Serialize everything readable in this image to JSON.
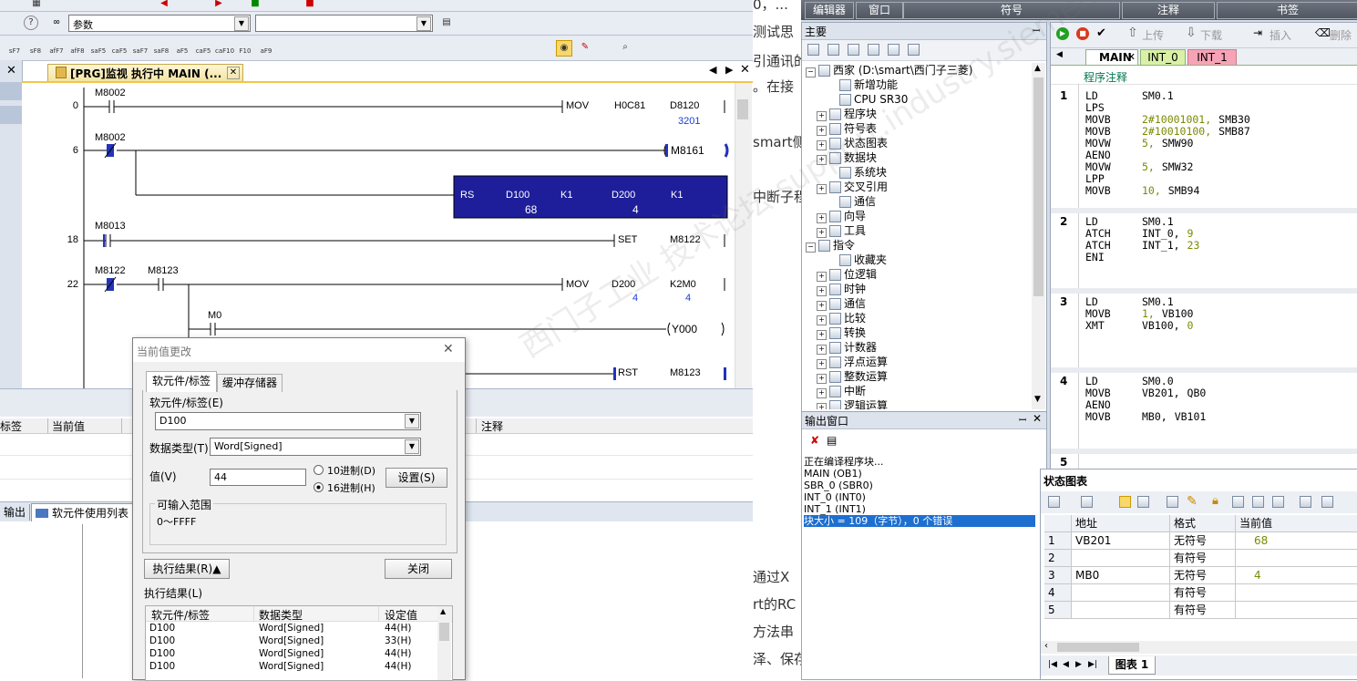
{
  "gxworks": {
    "toolbar_combo1": "参数",
    "tab_title": "[PRG]监视 执行中 MAIN (...",
    "toolbar_sf_labels": [
      "sF7",
      "sF8",
      "afF7",
      "afF8",
      "saF5",
      "caF5",
      "saF7",
      "saF8",
      "aF5",
      "caF5",
      "caF10",
      "F10",
      "aF9"
    ],
    "rungs": [
      {
        "step": "0",
        "contact": "M8002",
        "instr": "MOV",
        "op1": "H0C81",
        "op2": "D8120",
        "val2": "3201"
      },
      {
        "step": "6",
        "contact": "M8002",
        "coil": "M8161"
      },
      {
        "rs_instr": "RS",
        "rs_args": [
          "D100",
          "K1",
          "D200",
          "K1"
        ],
        "rs_vals": [
          "68",
          "4"
        ]
      },
      {
        "step": "18",
        "contact": "M8013",
        "instr": "SET",
        "op1": "M8122"
      },
      {
        "step": "22",
        "contact": "M8122",
        "contact2": "M8123",
        "instr": "MOV",
        "op1": "D200",
        "op2": "K2M0",
        "val1": "4",
        "val2": "4"
      },
      {
        "contact": "M0",
        "coil": "Y000"
      },
      {
        "instr": "RST",
        "op1": "M8123"
      }
    ],
    "bottom_headers": [
      "标签",
      "当前值",
      "",
      "注释"
    ],
    "bottom_tabs": [
      "输出",
      "软元件使用列表"
    ]
  },
  "dialog": {
    "title": "当前值更改",
    "tabs": [
      "软元件/标签",
      "缓冲存储器"
    ],
    "device_label": "软元件/标签(E)",
    "device_value": "D100",
    "datatype_label": "数据类型(T)",
    "datatype_value": "Word[Signed]",
    "value_label": "值(V)",
    "value": "44",
    "radio_dec": "10进制(D)",
    "radio_hex": "16进制(H)",
    "set_button": "设置(S)",
    "range_label": "可输入范围",
    "range_value": "0～FFFF",
    "result_button": "执行结果(R)▲",
    "close_button": "关闭",
    "result_label": "执行结果(L)",
    "result_headers": [
      "软元件/标签",
      "数据类型",
      "设定值"
    ],
    "result_rows": [
      [
        "D100",
        "Word[Signed]",
        "44(H)"
      ],
      [
        "D100",
        "Word[Signed]",
        "33(H)"
      ],
      [
        "D100",
        "Word[Signed]",
        "44(H)"
      ],
      [
        "D100",
        "Word[Signed]",
        "44(H)"
      ]
    ]
  },
  "article": {
    "fragments": [
      "0，...",
      "测试思",
      "引通讯的",
      "。在接",
      "smart侧",
      "中断子程",
      "通过X",
      "rt的RC",
      "方法串",
      "泽、保存"
    ]
  },
  "smart": {
    "menu_tabs": [
      "编辑器",
      "窗口",
      "符号",
      "注释",
      "书签"
    ],
    "tree_panel_title": "主要",
    "tree_items": [
      {
        "label": "西家 (D:\\smart\\西门子三菱)",
        "indent": 0
      },
      {
        "label": "新增功能",
        "indent": 2
      },
      {
        "label": "CPU SR30",
        "indent": 2
      },
      {
        "label": "程序块",
        "indent": 1
      },
      {
        "label": "符号表",
        "indent": 1
      },
      {
        "label": "状态图表",
        "indent": 1
      },
      {
        "label": "数据块",
        "indent": 1
      },
      {
        "label": "系统块",
        "indent": 2
      },
      {
        "label": "交叉引用",
        "indent": 1
      },
      {
        "label": "通信",
        "indent": 2
      },
      {
        "label": "向导",
        "indent": 1
      },
      {
        "label": "工具",
        "indent": 1
      },
      {
        "label": "指令",
        "indent": 0
      },
      {
        "label": "收藏夹",
        "indent": 2
      },
      {
        "label": "位逻辑",
        "indent": 1
      },
      {
        "label": "时钟",
        "indent": 1
      },
      {
        "label": "通信",
        "indent": 1
      },
      {
        "label": "比较",
        "indent": 1
      },
      {
        "label": "转换",
        "indent": 1
      },
      {
        "label": "计数器",
        "indent": 1
      },
      {
        "label": "浮点运算",
        "indent": 1
      },
      {
        "label": "整数运算",
        "indent": 1
      },
      {
        "label": "中断",
        "indent": 1
      },
      {
        "label": "逻辑运算",
        "indent": 1
      }
    ],
    "output_title": "输出窗口",
    "output_lines": [
      "正在编译程序块...",
      "MAIN (OB1)",
      "SBR_0 (SBR0)",
      "INT_0 (INT0)",
      "INT_1 (INT1)",
      "块大小 = 109（字节），0 个错误"
    ],
    "code_toolbar": [
      "上传",
      "下载",
      "插入",
      "删除"
    ],
    "code_tabs": [
      "MAIN",
      "INT_0",
      "INT_1"
    ],
    "program_comment": "程序注释",
    "networks": [
      {
        "num": "1",
        "lines": [
          [
            "LD",
            "SM0.1",
            ""
          ],
          [
            "LPS",
            "",
            ""
          ],
          [
            "MOVB",
            "2#10001001,",
            "SMB30"
          ],
          [
            "MOVB",
            "2#10010100,",
            "SMB87"
          ],
          [
            "MOVW",
            "5,",
            "SMW90"
          ],
          [
            "AENO",
            "",
            ""
          ],
          [
            "MOVW",
            "5,",
            "SMW32"
          ],
          [
            "LPP",
            "",
            ""
          ],
          [
            "MOVB",
            "10,",
            "SMB94"
          ]
        ]
      },
      {
        "num": "2",
        "lines": [
          [
            "LD",
            "SM0.1",
            ""
          ],
          [
            "ATCH",
            "INT_0,",
            "9"
          ],
          [
            "ATCH",
            "INT_1,",
            "23"
          ],
          [
            "ENI",
            "",
            ""
          ]
        ]
      },
      {
        "num": "3",
        "lines": [
          [
            "LD",
            "SM0.1",
            ""
          ],
          [
            "MOVB",
            "1,",
            "VB100"
          ],
          [
            "XMT",
            "VB100,",
            "0"
          ]
        ]
      },
      {
        "num": "4",
        "lines": [
          [
            "LD",
            "SM0.0",
            ""
          ],
          [
            "MOVB",
            "VB201,",
            "QB0"
          ],
          [
            "AENO",
            "",
            ""
          ],
          [
            "MOVB",
            "MB0,",
            "VB101"
          ]
        ]
      },
      {
        "num": "5",
        "lines": []
      }
    ],
    "status_chart": {
      "title": "状态图表",
      "headers": [
        "",
        "地址",
        "格式",
        "当前值"
      ],
      "rows": [
        [
          "1",
          "VB201",
          "无符号",
          "68"
        ],
        [
          "2",
          "",
          "有符号",
          ""
        ],
        [
          "3",
          "MB0",
          "无符号",
          "4"
        ],
        [
          "4",
          "",
          "有符号",
          ""
        ],
        [
          "5",
          "",
          "有符号",
          ""
        ]
      ],
      "sheet_tab": "图表 1"
    },
    "watermark": "西门子工业 技术论坛 support.industry.siemens.com"
  }
}
